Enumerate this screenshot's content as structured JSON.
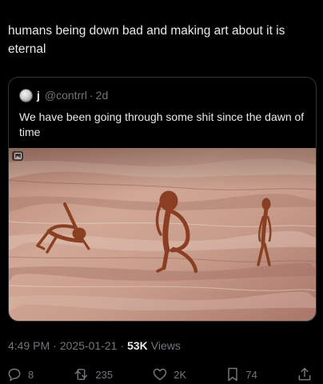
{
  "post": {
    "text": "humans being down bad and making art about it is eternal"
  },
  "quote": {
    "display_name": "j",
    "handle": "@contrrl",
    "separator": "·",
    "time": "2d",
    "text": "We have been going through some shit since the dawn of time",
    "image_icon": "cave-painting-image"
  },
  "meta": {
    "time": "4:49 PM",
    "separator": "·",
    "date": "2025-01-21",
    "views_count": "53K",
    "views_label": "Views"
  },
  "actions": {
    "replies": "8",
    "reposts": "235",
    "likes": "2K",
    "bookmarks": "74"
  },
  "colors": {
    "background": "#000000",
    "text_primary": "#e7e9ea",
    "text_secondary": "#71767b",
    "border": "#2f3336",
    "rock": "#c79a86",
    "pigment": "#8a3f22"
  }
}
